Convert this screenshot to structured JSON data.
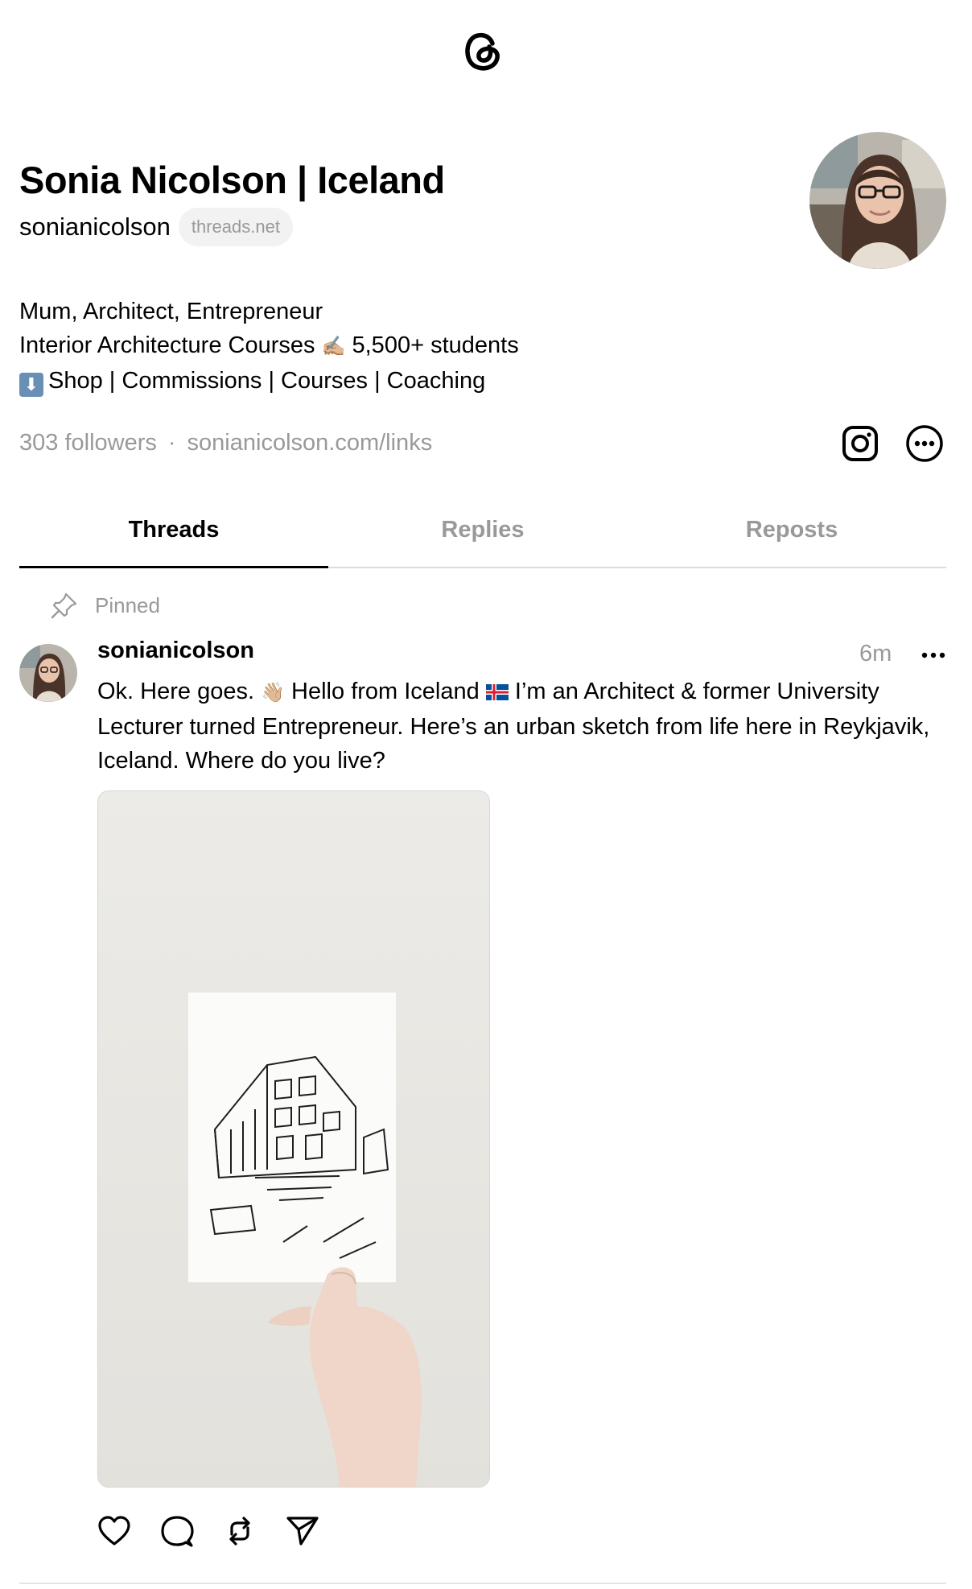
{
  "profile": {
    "name": "Sonia Nicolson | Iceland",
    "handle": "sonianicolson",
    "domain_pill": "threads.net",
    "bio": {
      "line1": "Mum, Architect, Entrepreneur",
      "line2": "Interior Architecture Courses",
      "line2_suffix": "5,500+ students",
      "line3": "Shop | Commissions | Courses | Coaching"
    },
    "followers": "303 followers",
    "separator": "·",
    "link": "sonianicolson.com/links"
  },
  "tabs": [
    {
      "label": "Threads",
      "active": true
    },
    {
      "label": "Replies",
      "active": false
    },
    {
      "label": "Reposts",
      "active": false
    }
  ],
  "post": {
    "pinned_label": "Pinned",
    "username": "sonianicolson",
    "time": "6m",
    "text_part1": "Ok. Here goes.",
    "text_part2": "Hello from Iceland",
    "text_part3": "I’m an Architect & former University Lecturer turned Entrepreneur. Here’s an urban sketch from life here in Reykjavik, Iceland. Where do you live?"
  },
  "icons": {
    "logo": "threads-logo-icon",
    "instagram": "instagram-icon",
    "more": "more-circle-icon",
    "pin": "pin-icon",
    "like": "heart-icon",
    "reply": "comment-icon",
    "repost": "repost-icon",
    "share": "send-icon"
  },
  "colors": {
    "text": "#000000",
    "muted": "#999999",
    "divider": "#dcdcdc"
  }
}
